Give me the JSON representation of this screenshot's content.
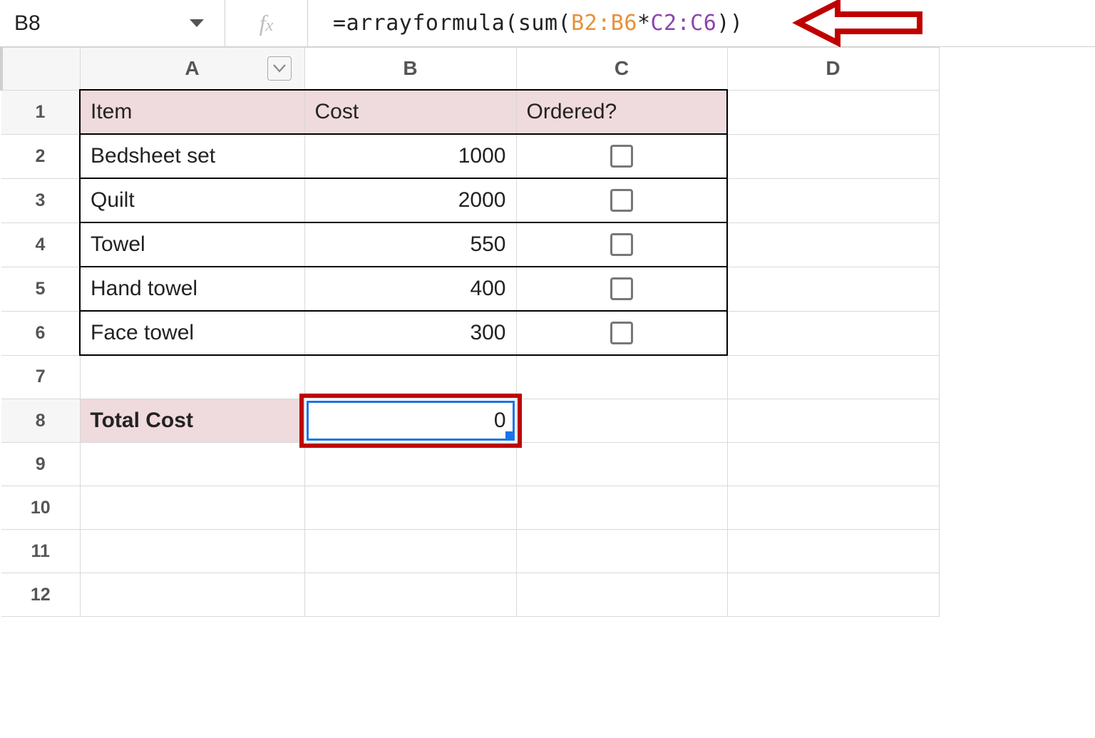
{
  "namebox": {
    "cell_ref": "B8"
  },
  "formula_bar": {
    "prefix": "=",
    "fn_open": "arrayformula(",
    "inner_fn": "sum(",
    "range_a": "B2:B6",
    "op": "*",
    "range_b": "C2:C6",
    "close": "))"
  },
  "columns": [
    "A",
    "B",
    "C",
    "D"
  ],
  "row_numbers": [
    "1",
    "2",
    "3",
    "4",
    "5",
    "6",
    "7",
    "8",
    "9",
    "10",
    "11",
    "12"
  ],
  "headers": {
    "item": "Item",
    "cost": "Cost",
    "ordered": "Ordered?"
  },
  "rows": [
    {
      "item": "Bedsheet set",
      "cost": "1000",
      "ordered": false
    },
    {
      "item": "Quilt",
      "cost": "2000",
      "ordered": false
    },
    {
      "item": "Towel",
      "cost": "550",
      "ordered": false
    },
    {
      "item": "Hand towel",
      "cost": "400",
      "ordered": false
    },
    {
      "item": "Face towel",
      "cost": "300",
      "ordered": false
    }
  ],
  "total": {
    "label": "Total Cost",
    "value": "0"
  },
  "selected_cell": "B8",
  "icons": {
    "namebox_caret": "caret-down-icon",
    "col_dd": "chevron-down-icon",
    "annotation_arrow": "arrow-left-icon"
  },
  "chart_data": {
    "type": "table",
    "columns": [
      "Item",
      "Cost",
      "Ordered?"
    ],
    "rows": [
      [
        "Bedsheet set",
        1000,
        false
      ],
      [
        "Quilt",
        2000,
        false
      ],
      [
        "Towel",
        550,
        false
      ],
      [
        "Hand towel",
        400,
        false
      ],
      [
        "Face towel",
        300,
        false
      ]
    ],
    "summary": {
      "label": "Total Cost",
      "formula": "=arrayformula(sum(B2:B6*C2:C6))",
      "value": 0
    }
  }
}
